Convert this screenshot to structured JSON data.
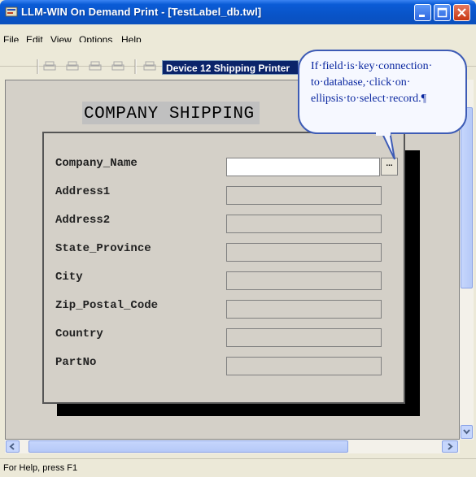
{
  "window": {
    "title": "LLM-WIN On Demand Print - [TestLabel_db.twl]"
  },
  "menu": {
    "items": [
      "File",
      "Edit",
      "View",
      "Options",
      "Help"
    ]
  },
  "toolbar": {
    "printer": "Device 12 Shipping Printer"
  },
  "form": {
    "title": "COMPANY SHIPPING",
    "fields": [
      {
        "label": "Company_Name",
        "value": ""
      },
      {
        "label": "Address1",
        "value": ""
      },
      {
        "label": "Address2",
        "value": ""
      },
      {
        "label": "State_Province",
        "value": ""
      },
      {
        "label": "City",
        "value": ""
      },
      {
        "label": "Zip_Postal_Code",
        "value": ""
      },
      {
        "label": "Country",
        "value": ""
      },
      {
        "label": "PartNo",
        "value": ""
      }
    ],
    "ellipsis_label": "..."
  },
  "callout": {
    "text": "If·field·is·key·connection· to·database,·click·on· ellipsis·to·select·record.¶"
  },
  "status": {
    "text": "For Help, press F1"
  },
  "colors": {
    "title_bar": "#0a5bd6",
    "callout_border": "#3d5bb5",
    "callout_text": "#0a27a0"
  },
  "icons": [
    "app-icon",
    "open-folder-icon",
    "print-icon",
    "minimize-icon",
    "maximize-icon",
    "close-icon"
  ]
}
